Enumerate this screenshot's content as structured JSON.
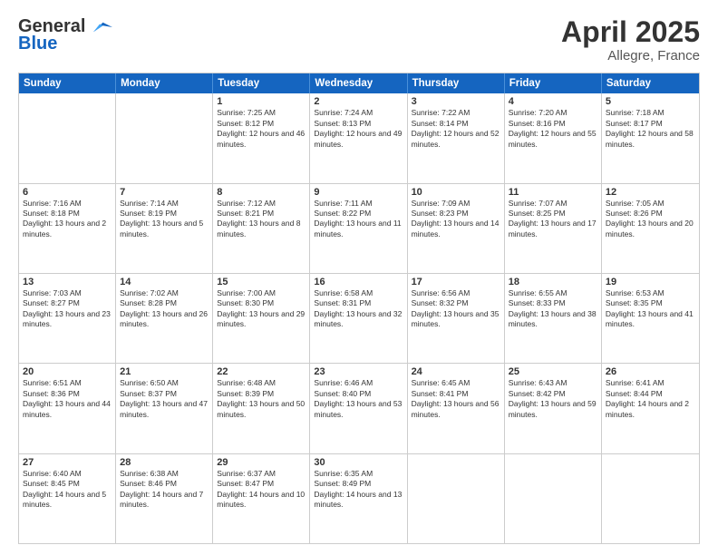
{
  "header": {
    "logo_general": "General",
    "logo_blue": "Blue",
    "month_title": "April 2025",
    "location": "Allegre, France"
  },
  "days_of_week": [
    "Sunday",
    "Monday",
    "Tuesday",
    "Wednesday",
    "Thursday",
    "Friday",
    "Saturday"
  ],
  "weeks": [
    [
      {
        "day": "",
        "info": ""
      },
      {
        "day": "",
        "info": ""
      },
      {
        "day": "1",
        "info": "Sunrise: 7:25 AM\nSunset: 8:12 PM\nDaylight: 12 hours and 46 minutes."
      },
      {
        "day": "2",
        "info": "Sunrise: 7:24 AM\nSunset: 8:13 PM\nDaylight: 12 hours and 49 minutes."
      },
      {
        "day": "3",
        "info": "Sunrise: 7:22 AM\nSunset: 8:14 PM\nDaylight: 12 hours and 52 minutes."
      },
      {
        "day": "4",
        "info": "Sunrise: 7:20 AM\nSunset: 8:16 PM\nDaylight: 12 hours and 55 minutes."
      },
      {
        "day": "5",
        "info": "Sunrise: 7:18 AM\nSunset: 8:17 PM\nDaylight: 12 hours and 58 minutes."
      }
    ],
    [
      {
        "day": "6",
        "info": "Sunrise: 7:16 AM\nSunset: 8:18 PM\nDaylight: 13 hours and 2 minutes."
      },
      {
        "day": "7",
        "info": "Sunrise: 7:14 AM\nSunset: 8:19 PM\nDaylight: 13 hours and 5 minutes."
      },
      {
        "day": "8",
        "info": "Sunrise: 7:12 AM\nSunset: 8:21 PM\nDaylight: 13 hours and 8 minutes."
      },
      {
        "day": "9",
        "info": "Sunrise: 7:11 AM\nSunset: 8:22 PM\nDaylight: 13 hours and 11 minutes."
      },
      {
        "day": "10",
        "info": "Sunrise: 7:09 AM\nSunset: 8:23 PM\nDaylight: 13 hours and 14 minutes."
      },
      {
        "day": "11",
        "info": "Sunrise: 7:07 AM\nSunset: 8:25 PM\nDaylight: 13 hours and 17 minutes."
      },
      {
        "day": "12",
        "info": "Sunrise: 7:05 AM\nSunset: 8:26 PM\nDaylight: 13 hours and 20 minutes."
      }
    ],
    [
      {
        "day": "13",
        "info": "Sunrise: 7:03 AM\nSunset: 8:27 PM\nDaylight: 13 hours and 23 minutes."
      },
      {
        "day": "14",
        "info": "Sunrise: 7:02 AM\nSunset: 8:28 PM\nDaylight: 13 hours and 26 minutes."
      },
      {
        "day": "15",
        "info": "Sunrise: 7:00 AM\nSunset: 8:30 PM\nDaylight: 13 hours and 29 minutes."
      },
      {
        "day": "16",
        "info": "Sunrise: 6:58 AM\nSunset: 8:31 PM\nDaylight: 13 hours and 32 minutes."
      },
      {
        "day": "17",
        "info": "Sunrise: 6:56 AM\nSunset: 8:32 PM\nDaylight: 13 hours and 35 minutes."
      },
      {
        "day": "18",
        "info": "Sunrise: 6:55 AM\nSunset: 8:33 PM\nDaylight: 13 hours and 38 minutes."
      },
      {
        "day": "19",
        "info": "Sunrise: 6:53 AM\nSunset: 8:35 PM\nDaylight: 13 hours and 41 minutes."
      }
    ],
    [
      {
        "day": "20",
        "info": "Sunrise: 6:51 AM\nSunset: 8:36 PM\nDaylight: 13 hours and 44 minutes."
      },
      {
        "day": "21",
        "info": "Sunrise: 6:50 AM\nSunset: 8:37 PM\nDaylight: 13 hours and 47 minutes."
      },
      {
        "day": "22",
        "info": "Sunrise: 6:48 AM\nSunset: 8:39 PM\nDaylight: 13 hours and 50 minutes."
      },
      {
        "day": "23",
        "info": "Sunrise: 6:46 AM\nSunset: 8:40 PM\nDaylight: 13 hours and 53 minutes."
      },
      {
        "day": "24",
        "info": "Sunrise: 6:45 AM\nSunset: 8:41 PM\nDaylight: 13 hours and 56 minutes."
      },
      {
        "day": "25",
        "info": "Sunrise: 6:43 AM\nSunset: 8:42 PM\nDaylight: 13 hours and 59 minutes."
      },
      {
        "day": "26",
        "info": "Sunrise: 6:41 AM\nSunset: 8:44 PM\nDaylight: 14 hours and 2 minutes."
      }
    ],
    [
      {
        "day": "27",
        "info": "Sunrise: 6:40 AM\nSunset: 8:45 PM\nDaylight: 14 hours and 5 minutes."
      },
      {
        "day": "28",
        "info": "Sunrise: 6:38 AM\nSunset: 8:46 PM\nDaylight: 14 hours and 7 minutes."
      },
      {
        "day": "29",
        "info": "Sunrise: 6:37 AM\nSunset: 8:47 PM\nDaylight: 14 hours and 10 minutes."
      },
      {
        "day": "30",
        "info": "Sunrise: 6:35 AM\nSunset: 8:49 PM\nDaylight: 14 hours and 13 minutes."
      },
      {
        "day": "",
        "info": ""
      },
      {
        "day": "",
        "info": ""
      },
      {
        "day": "",
        "info": ""
      }
    ]
  ]
}
